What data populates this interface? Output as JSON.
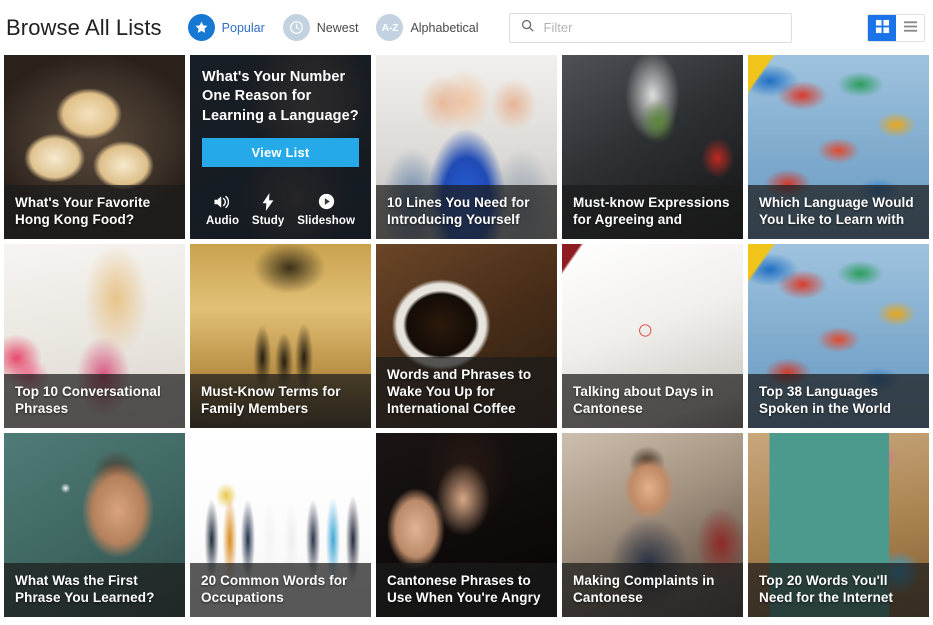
{
  "header": {
    "title": "Browse All Lists",
    "sorts": [
      {
        "label": "Popular",
        "icon": "star-icon",
        "active": true
      },
      {
        "label": "Newest",
        "icon": "clock-icon",
        "active": false
      },
      {
        "label": "Alphabetical",
        "icon": "alphabetical-az-icon",
        "active": false,
        "badge_text": "A-Z"
      }
    ],
    "search": {
      "placeholder": "Filter",
      "value": "",
      "icon": "search-icon"
    },
    "view_toggle": [
      {
        "name": "grid-view",
        "icon": "grid-icon",
        "active": true
      },
      {
        "name": "list-view",
        "icon": "list-icon",
        "active": false
      }
    ]
  },
  "colors": {
    "accent_blue": "#1778d4",
    "active_toggle_blue": "#1a73e8",
    "view_list_button": "#25a9e8",
    "inactive_badge": "#c3d2e0",
    "title_overlay": "rgba(28,28,28,.72)"
  },
  "hovered_card": {
    "index": 1,
    "view_list_label": "View List",
    "actions": [
      {
        "label": "Audio",
        "icon": "speaker-icon"
      },
      {
        "label": "Study",
        "icon": "lightning-bolt-icon"
      },
      {
        "label": "Slideshow",
        "icon": "play-circle-icon"
      }
    ]
  },
  "cards": [
    {
      "title": "What's Your Favorite Hong Kong Food?",
      "image": "dim-sum-dumplings-in-bamboo-steamer"
    },
    {
      "title": "What's Your Number One Reason for Learning a Language?",
      "image": "man-thinking-dark-portrait"
    },
    {
      "title": "10 Lines You Need for Introducing Yourself",
      "image": "businesswoman-in-blue-blazer-with-team"
    },
    {
      "title": "Must-know Expressions for Agreeing and",
      "image": "businessman-holding-green-sprout"
    },
    {
      "title": "Which Language Would You Like to Learn with",
      "image": "colorful-flags-against-blue-sky"
    },
    {
      "title": "Top 10 Conversational Phrases",
      "image": "woman-whispering-with-flowers"
    },
    {
      "title": "Must-Know Terms for Family Members",
      "image": "family-silhouette-at-sunset"
    },
    {
      "title": "Words and Phrases to Wake You Up for International Coffee",
      "image": "coffee-cup-on-coffee-beans"
    },
    {
      "title": "Talking about Days in Cantonese",
      "image": "calendar-with-circled-date"
    },
    {
      "title": "Top 38 Languages Spoken in the World",
      "image": "colorful-flags-against-blue-sky"
    },
    {
      "title": "What Was the First Phrase You Learned?",
      "image": "man-writing-on-chalkboard"
    },
    {
      "title": "20 Common Words for Occupations",
      "image": "group-of-people-in-various-professions"
    },
    {
      "title": "Cantonese Phrases to Use When You're Angry",
      "image": "woman-holding-up-hand-stop-gesture"
    },
    {
      "title": "Making Complaints in Cantonese",
      "image": "angry-man-gesturing-in-restaurant"
    },
    {
      "title": "Top 20 Words You'll Need for the Internet",
      "image": "desktop-monitor-showing-www"
    }
  ]
}
